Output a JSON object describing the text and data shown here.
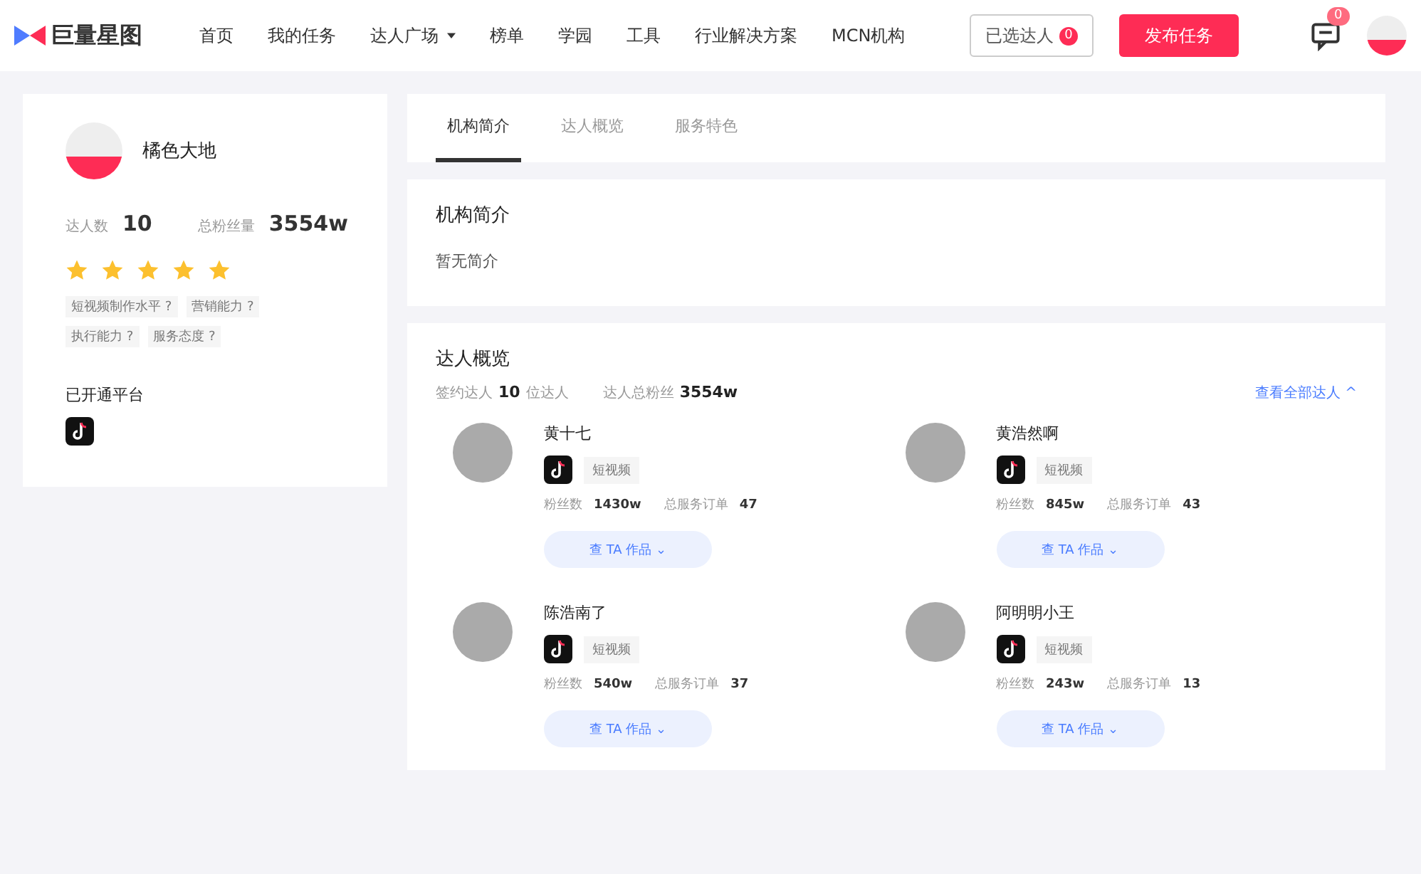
{
  "header": {
    "logo": "巨量星图",
    "nav": [
      {
        "label": "首页",
        "selected": false,
        "dropdown": false
      },
      {
        "label": "我的任务",
        "selected": false,
        "dropdown": false
      },
      {
        "label": "达人广场",
        "selected": false,
        "dropdown": true
      },
      {
        "label": "榜单",
        "selected": false,
        "dropdown": false
      },
      {
        "label": "学园",
        "selected": false,
        "dropdown": false
      },
      {
        "label": "工具",
        "selected": false,
        "dropdown": false
      },
      {
        "label": "行业解决方案",
        "selected": false,
        "dropdown": false
      },
      {
        "label": "MCN机构",
        "selected": false,
        "dropdown": false
      }
    ],
    "selected_button": {
      "label": "已选达人",
      "badge": "0"
    },
    "publish_button": "发布任务",
    "message_badge": "0"
  },
  "profile": {
    "name": "橘色大地",
    "stats": [
      {
        "label": "达人数",
        "value": "10"
      },
      {
        "label": "总粉丝量",
        "value": "3554w"
      }
    ],
    "stars": 5,
    "tags": [
      "短视频制作水平 ?",
      "营销能力 ?",
      "执行能力 ?",
      "服务态度 ?"
    ],
    "platforms_title": "已开通平台"
  },
  "tabs": [
    {
      "label": "机构简介",
      "selected": true
    },
    {
      "label": "达人概览",
      "selected": false
    },
    {
      "label": "服务特色",
      "selected": false
    }
  ],
  "intro": {
    "title": "机构简介",
    "text": "暂无简介"
  },
  "overview": {
    "title": "达人概览",
    "stats": [
      {
        "label": "签约达人",
        "value": "10",
        "unit": "位达人"
      },
      {
        "label": "达人总粉丝",
        "value": "3554w"
      }
    ],
    "view_all": "查看全部达人 ^",
    "creators": [
      {
        "name": "黄十七",
        "tag": "短视频",
        "fans_label": "粉丝数",
        "fans": "1430w",
        "orders_label": "总服务订单",
        "orders": "47",
        "button": "查 TA 作品 ⌄"
      },
      {
        "name": "黄浩然啊",
        "tag": "短视频",
        "fans_label": "粉丝数",
        "fans": "845w",
        "orders_label": "总服务订单",
        "orders": "43",
        "button": "查 TA 作品 ⌄"
      },
      {
        "name": "陈浩南了",
        "tag": "短视频",
        "fans_label": "粉丝数",
        "fans": "540w",
        "orders_label": "总服务订单",
        "orders": "37",
        "button": "查 TA 作品 ⌄"
      },
      {
        "name": "阿明明小王",
        "tag": "短视频",
        "fans_label": "粉丝数",
        "fans": "243w",
        "orders_label": "总服务订单",
        "orders": "13",
        "button": "查 TA 作品 ⌄"
      }
    ]
  }
}
